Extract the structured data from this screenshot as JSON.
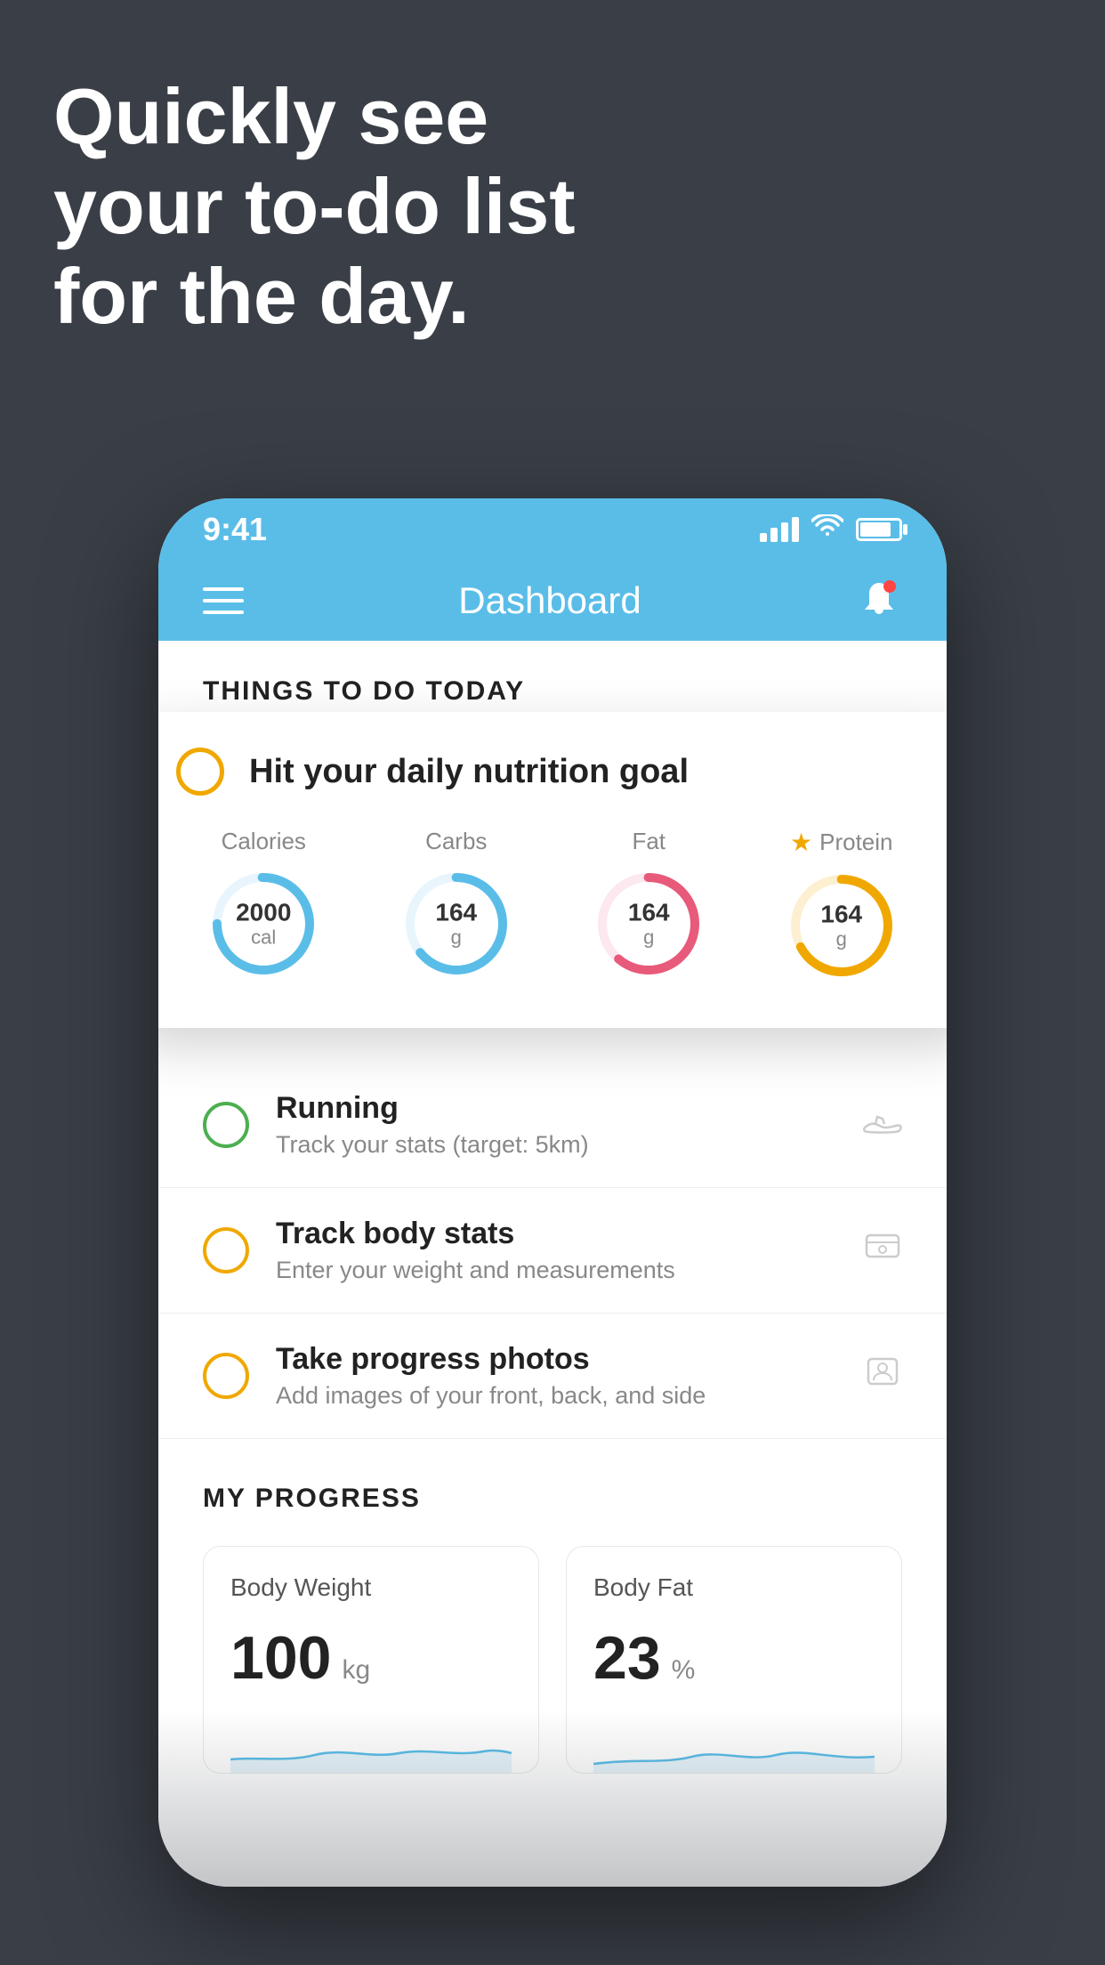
{
  "headline": {
    "line1": "Quickly see",
    "line2": "your to-do list",
    "line3": "for the day."
  },
  "status_bar": {
    "time": "9:41",
    "color": "#5abde8"
  },
  "nav": {
    "title": "Dashboard"
  },
  "section1": {
    "header": "THINGS TO DO TODAY"
  },
  "floating_card": {
    "title": "Hit your daily nutrition goal",
    "nutrients": [
      {
        "label": "Calories",
        "value": "2000",
        "unit": "cal",
        "color": "#5abde8",
        "starred": false
      },
      {
        "label": "Carbs",
        "value": "164",
        "unit": "g",
        "color": "#5abde8",
        "starred": false
      },
      {
        "label": "Fat",
        "value": "164",
        "unit": "g",
        "color": "#e85a7a",
        "starred": false
      },
      {
        "label": "Protein",
        "value": "164",
        "unit": "g",
        "color": "#f0a800",
        "starred": true
      }
    ]
  },
  "list_items": [
    {
      "title": "Running",
      "subtitle": "Track your stats (target: 5km)",
      "circle_color": "green",
      "icon": "shoe"
    },
    {
      "title": "Track body stats",
      "subtitle": "Enter your weight and measurements",
      "circle_color": "yellow",
      "icon": "scale"
    },
    {
      "title": "Take progress photos",
      "subtitle": "Add images of your front, back, and side",
      "circle_color": "yellow",
      "icon": "person"
    }
  ],
  "progress": {
    "section_title": "MY PROGRESS",
    "cards": [
      {
        "title": "Body Weight",
        "value": "100",
        "unit": "kg"
      },
      {
        "title": "Body Fat",
        "value": "23",
        "unit": "%"
      }
    ]
  }
}
